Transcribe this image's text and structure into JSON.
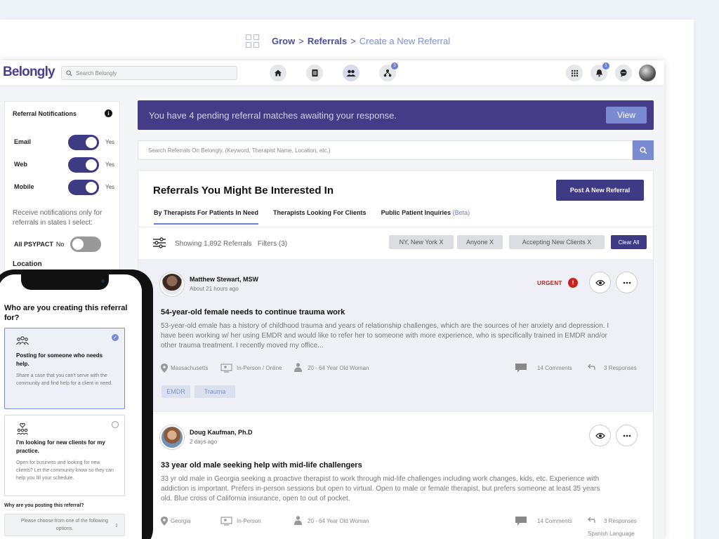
{
  "breadcrumb": {
    "grow": "Grow",
    "sep1": ">",
    "referrals": "Referrals",
    "sep2": ">",
    "current": "Create a New Referral"
  },
  "topbar": {
    "logo": "Belongly",
    "search_placeholder": "Search Belongly",
    "nav_badge": "3",
    "bell_badge": "1"
  },
  "sidebar": {
    "title": "Referral Notifications",
    "info": "i",
    "rows": [
      {
        "label": "Email",
        "state": "Yes",
        "on": true
      },
      {
        "label": "Web",
        "state": "Yes",
        "on": true
      },
      {
        "label": "Mobile",
        "state": "Yes",
        "on": true
      }
    ],
    "note": "Receive notifications only for referrals in states I select:",
    "psypact": {
      "label": "All PSYPACT",
      "state": "No",
      "on": false
    },
    "location": "Location"
  },
  "banner": {
    "text": "You have 4 pending referral matches awaiting your response.",
    "button": "View"
  },
  "referral_search": {
    "placeholder": "Search Referrals On Belongly. (Keyword, Therapist Name, Location, etc.)"
  },
  "main": {
    "title": "Referrals You Might Be Interested In",
    "post_button": "Post A New Referral",
    "tabs": [
      {
        "label": "By Therapists For Patients In Need",
        "active": true
      },
      {
        "label": "Therapists Looking For Clients",
        "active": false
      },
      {
        "label": "Public Patient Inquiries",
        "suffix": "(Beta)",
        "active": false
      }
    ],
    "showing": "Showing 1,892 Referrals",
    "filters": "Filters (3)",
    "chips": [
      "NY, New York  X",
      "Anyone  X",
      "Accepting New Clients  X"
    ],
    "clear_all": "Clear All"
  },
  "cards": [
    {
      "name": "Matthew Stewart, MSW",
      "time": "About 21 hours ago",
      "urgent": "URGENT",
      "urgent_icon": "!",
      "title": "54-year-old  female needs to continue trauma work",
      "body": "53-year-old emale has a history of childhood trauma and years of relationship challenges, which are the sources of her anxiety and depression.   I have been working w/ her using EMDR and would like to refer her to someone with more experience, who is specifically trained in EMDR and/or other trauma treatment.  I recently moved my office...",
      "location": "Massachusetts",
      "mode": "In-Person / Online",
      "age": "20 - 64 Year Old Woman",
      "comments": "14 Comments",
      "responses": "3 Responses",
      "tags": [
        "EMDR",
        "Trauma"
      ]
    },
    {
      "name": "Doug Kaufman, Ph.D",
      "time": "2 days ago",
      "title": "33 year old male seeking help with mid-life challengers",
      "body": "33 yr old male in Georgia seeking a proactive therapist to work through mid-life challenges including work changes, kids, etc. Experience with addiction is important. Prefers in-person sessions but open to virtual. Open to male or female therapist, but prefers someone at least 35 years old. Blue cross of California insurance, open to out of pocket.",
      "location": "Georgia",
      "mode": "In-Person",
      "age": "20 - 64 Year Old Woman",
      "comments": "14 Comments",
      "responses": "3 Responses",
      "language": "Spanish Language"
    }
  ],
  "phone": {
    "question": "Who are you creating this referral for?",
    "options": [
      {
        "title": "Posting for someone who needs help.",
        "desc": "Share a case that you can't serve with the community and find help for a client in need.",
        "selected": true,
        "check": "✓"
      },
      {
        "title": "I'm looking for new clients for my practice.",
        "desc": "Open for business and looking for new clients? Let the community know so they can help you fill your schedule.",
        "selected": false
      }
    ],
    "why_label": "Why are you posting this referral?",
    "select_placeholder": "Please choose from one of the following options."
  },
  "colors": {
    "brand": "#3e3a83",
    "accent": "#7b8bd2",
    "urgent": "#cc1f1f"
  }
}
